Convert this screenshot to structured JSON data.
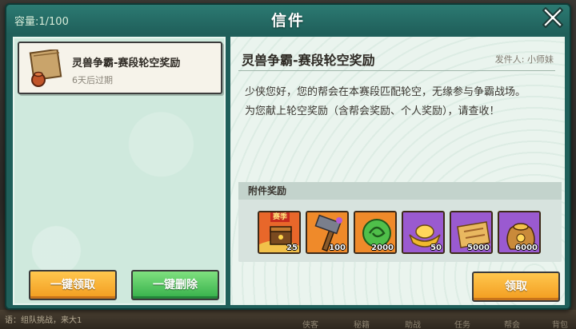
{
  "window": {
    "title": "信件",
    "capacity": "容量:1/100"
  },
  "mail_list": [
    {
      "title": "灵兽争霸-赛段轮空奖励",
      "expire": "6天后过期",
      "icon": "mail-envelope-icon"
    }
  ],
  "buttons": {
    "claim_all": "一键领取",
    "delete_all": "一键删除",
    "claim": "领取"
  },
  "detail": {
    "title": "灵兽争霸-赛段轮空奖励",
    "sender": "发件人: 小师妹",
    "body_line1": "少侠您好，您的帮会在本赛段匹配轮空，无缘参与争霸战场。",
    "body_line2": "为您献上轮空奖励（含帮会奖励、个人奖励），请查收！",
    "attachment_header": "附件奖励"
  },
  "rewards": [
    {
      "icon": "season-chest-icon",
      "tag": "赛季",
      "count": "25"
    },
    {
      "icon": "hammer-icon",
      "count": "100"
    },
    {
      "icon": "jade-icon",
      "count": "2000"
    },
    {
      "icon": "gold-ingot-icon",
      "count": "50"
    },
    {
      "icon": "scroll-icon",
      "count": "5000"
    },
    {
      "icon": "treasure-sack-icon",
      "count": "6000"
    }
  ],
  "background": {
    "chat_text": "语：组队挑战，来大1",
    "nav_items": [
      "侠客",
      "秘籍",
      "助战",
      "任务",
      "帮会",
      "背包"
    ]
  },
  "colors": {
    "window_bg": "#1f5f5a",
    "accent_orange": "#f29c1f",
    "accent_green": "#35b04a"
  }
}
